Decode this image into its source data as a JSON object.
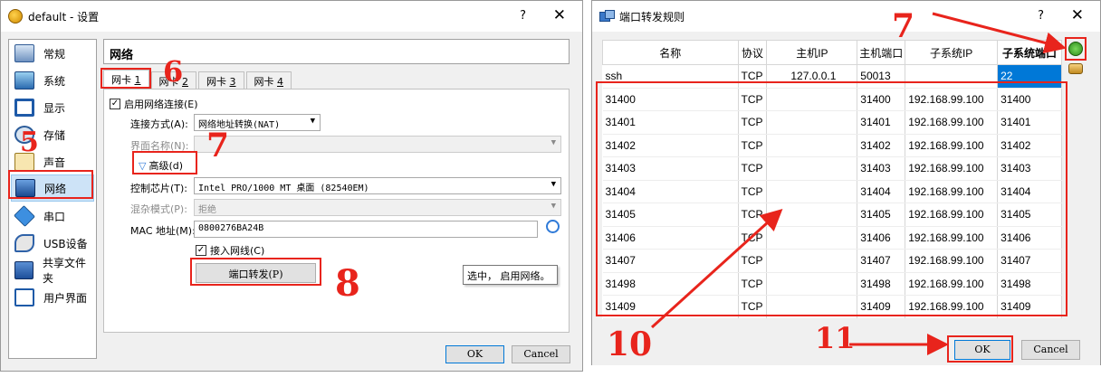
{
  "w1": {
    "title": "default - 设置",
    "help": "?",
    "close": "✕",
    "sidebar": [
      {
        "label": "常规",
        "icon": "general-icon"
      },
      {
        "label": "系统",
        "icon": "system-icon"
      },
      {
        "label": "显示",
        "icon": "display-icon"
      },
      {
        "label": "存储",
        "icon": "storage-icon"
      },
      {
        "label": "声音",
        "icon": "audio-icon"
      },
      {
        "label": "网络",
        "icon": "network-icon"
      },
      {
        "label": "串口",
        "icon": "serial-icon"
      },
      {
        "label": "USB设备",
        "icon": "usb-icon"
      },
      {
        "label": "共享文件夹",
        "icon": "shared-folder-icon"
      },
      {
        "label": "用户界面",
        "icon": "ui-icon"
      }
    ],
    "section_title": "网络",
    "tabs": [
      {
        "text": "网卡 ",
        "key": "1"
      },
      {
        "text": "网卡 ",
        "key": "2"
      },
      {
        "text": "网卡 ",
        "key": "3"
      },
      {
        "text": "网卡 ",
        "key": "4"
      }
    ],
    "enable_label": "启用网络连接(E)",
    "attach_label": "连接方式(A):",
    "attach_value": "网络地址转换(NAT)",
    "name_label": "界面名称(N):",
    "advanced_label": "高级(d)",
    "adapter_label": "控制芯片(T):",
    "adapter_value": "Intel PRO/1000 MT 桌面 (82540EM)",
    "promisc_label": "混杂模式(P):",
    "promisc_value": "拒绝",
    "mac_label": "MAC 地址(M):",
    "mac_value": "0800276BA24B",
    "cable_label": "接入网线(C)",
    "port_forward_button": "端口转发(P)",
    "tooltip": "选中， 启用网络。",
    "ok": "OK",
    "cancel": "Cancel"
  },
  "w2": {
    "title": "端口转发规则",
    "help": "?",
    "close": "✕",
    "columns": [
      "名称",
      "协议",
      "主机IP",
      "主机端口",
      "子系统IP",
      "子系统端口"
    ],
    "rows": [
      [
        "ssh",
        "TCP",
        "127.0.0.1",
        "50013",
        "",
        "22"
      ],
      [
        "31400",
        "TCP",
        "",
        "31400",
        "192.168.99.100",
        "31400"
      ],
      [
        "31401",
        "TCP",
        "",
        "31401",
        "192.168.99.100",
        "31401"
      ],
      [
        "31402",
        "TCP",
        "",
        "31402",
        "192.168.99.100",
        "31402"
      ],
      [
        "31403",
        "TCP",
        "",
        "31403",
        "192.168.99.100",
        "31403"
      ],
      [
        "31404",
        "TCP",
        "",
        "31404",
        "192.168.99.100",
        "31404"
      ],
      [
        "31405",
        "TCP",
        "",
        "31405",
        "192.168.99.100",
        "31405"
      ],
      [
        "31406",
        "TCP",
        "",
        "31406",
        "192.168.99.100",
        "31406"
      ],
      [
        "31407",
        "TCP",
        "",
        "31407",
        "192.168.99.100",
        "31407"
      ],
      [
        "31498",
        "TCP",
        "",
        "31498",
        "192.168.99.100",
        "31498"
      ],
      [
        "31409",
        "TCP",
        "",
        "31409",
        "192.168.99.100",
        "31409"
      ]
    ],
    "ok": "OK",
    "cancel": "Cancel"
  },
  "annotations": [
    "5",
    "6",
    "7",
    "8",
    "7",
    "10",
    "11"
  ],
  "colors": {
    "annotation": "#e8241c",
    "selection": "#0078d7"
  }
}
